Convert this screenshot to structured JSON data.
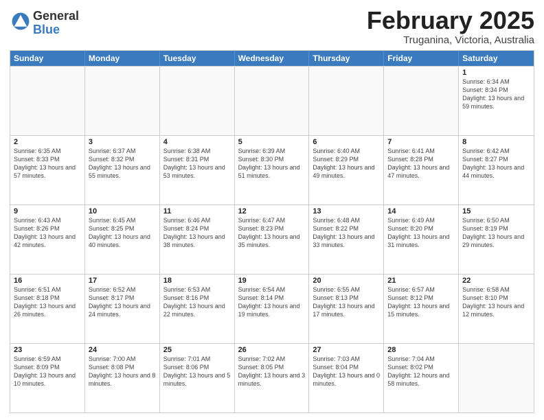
{
  "header": {
    "logo_general": "General",
    "logo_blue": "Blue",
    "title": "February 2025",
    "location": "Truganina, Victoria, Australia"
  },
  "days_of_week": [
    "Sunday",
    "Monday",
    "Tuesday",
    "Wednesday",
    "Thursday",
    "Friday",
    "Saturday"
  ],
  "weeks": [
    [
      {
        "day": "",
        "info": ""
      },
      {
        "day": "",
        "info": ""
      },
      {
        "day": "",
        "info": ""
      },
      {
        "day": "",
        "info": ""
      },
      {
        "day": "",
        "info": ""
      },
      {
        "day": "",
        "info": ""
      },
      {
        "day": "1",
        "info": "Sunrise: 6:34 AM\nSunset: 8:34 PM\nDaylight: 13 hours and 59 minutes."
      }
    ],
    [
      {
        "day": "2",
        "info": "Sunrise: 6:35 AM\nSunset: 8:33 PM\nDaylight: 13 hours and 57 minutes."
      },
      {
        "day": "3",
        "info": "Sunrise: 6:37 AM\nSunset: 8:32 PM\nDaylight: 13 hours and 55 minutes."
      },
      {
        "day": "4",
        "info": "Sunrise: 6:38 AM\nSunset: 8:31 PM\nDaylight: 13 hours and 53 minutes."
      },
      {
        "day": "5",
        "info": "Sunrise: 6:39 AM\nSunset: 8:30 PM\nDaylight: 13 hours and 51 minutes."
      },
      {
        "day": "6",
        "info": "Sunrise: 6:40 AM\nSunset: 8:29 PM\nDaylight: 13 hours and 49 minutes."
      },
      {
        "day": "7",
        "info": "Sunrise: 6:41 AM\nSunset: 8:28 PM\nDaylight: 13 hours and 47 minutes."
      },
      {
        "day": "8",
        "info": "Sunrise: 6:42 AM\nSunset: 8:27 PM\nDaylight: 13 hours and 44 minutes."
      }
    ],
    [
      {
        "day": "9",
        "info": "Sunrise: 6:43 AM\nSunset: 8:26 PM\nDaylight: 13 hours and 42 minutes."
      },
      {
        "day": "10",
        "info": "Sunrise: 6:45 AM\nSunset: 8:25 PM\nDaylight: 13 hours and 40 minutes."
      },
      {
        "day": "11",
        "info": "Sunrise: 6:46 AM\nSunset: 8:24 PM\nDaylight: 13 hours and 38 minutes."
      },
      {
        "day": "12",
        "info": "Sunrise: 6:47 AM\nSunset: 8:23 PM\nDaylight: 13 hours and 35 minutes."
      },
      {
        "day": "13",
        "info": "Sunrise: 6:48 AM\nSunset: 8:22 PM\nDaylight: 13 hours and 33 minutes."
      },
      {
        "day": "14",
        "info": "Sunrise: 6:49 AM\nSunset: 8:20 PM\nDaylight: 13 hours and 31 minutes."
      },
      {
        "day": "15",
        "info": "Sunrise: 6:50 AM\nSunset: 8:19 PM\nDaylight: 13 hours and 29 minutes."
      }
    ],
    [
      {
        "day": "16",
        "info": "Sunrise: 6:51 AM\nSunset: 8:18 PM\nDaylight: 13 hours and 26 minutes."
      },
      {
        "day": "17",
        "info": "Sunrise: 6:52 AM\nSunset: 8:17 PM\nDaylight: 13 hours and 24 minutes."
      },
      {
        "day": "18",
        "info": "Sunrise: 6:53 AM\nSunset: 8:16 PM\nDaylight: 13 hours and 22 minutes."
      },
      {
        "day": "19",
        "info": "Sunrise: 6:54 AM\nSunset: 8:14 PM\nDaylight: 13 hours and 19 minutes."
      },
      {
        "day": "20",
        "info": "Sunrise: 6:55 AM\nSunset: 8:13 PM\nDaylight: 13 hours and 17 minutes."
      },
      {
        "day": "21",
        "info": "Sunrise: 6:57 AM\nSunset: 8:12 PM\nDaylight: 13 hours and 15 minutes."
      },
      {
        "day": "22",
        "info": "Sunrise: 6:58 AM\nSunset: 8:10 PM\nDaylight: 13 hours and 12 minutes."
      }
    ],
    [
      {
        "day": "23",
        "info": "Sunrise: 6:59 AM\nSunset: 8:09 PM\nDaylight: 13 hours and 10 minutes."
      },
      {
        "day": "24",
        "info": "Sunrise: 7:00 AM\nSunset: 8:08 PM\nDaylight: 13 hours and 8 minutes."
      },
      {
        "day": "25",
        "info": "Sunrise: 7:01 AM\nSunset: 8:06 PM\nDaylight: 13 hours and 5 minutes."
      },
      {
        "day": "26",
        "info": "Sunrise: 7:02 AM\nSunset: 8:05 PM\nDaylight: 13 hours and 3 minutes."
      },
      {
        "day": "27",
        "info": "Sunrise: 7:03 AM\nSunset: 8:04 PM\nDaylight: 13 hours and 0 minutes."
      },
      {
        "day": "28",
        "info": "Sunrise: 7:04 AM\nSunset: 8:02 PM\nDaylight: 12 hours and 58 minutes."
      },
      {
        "day": "",
        "info": ""
      }
    ]
  ]
}
